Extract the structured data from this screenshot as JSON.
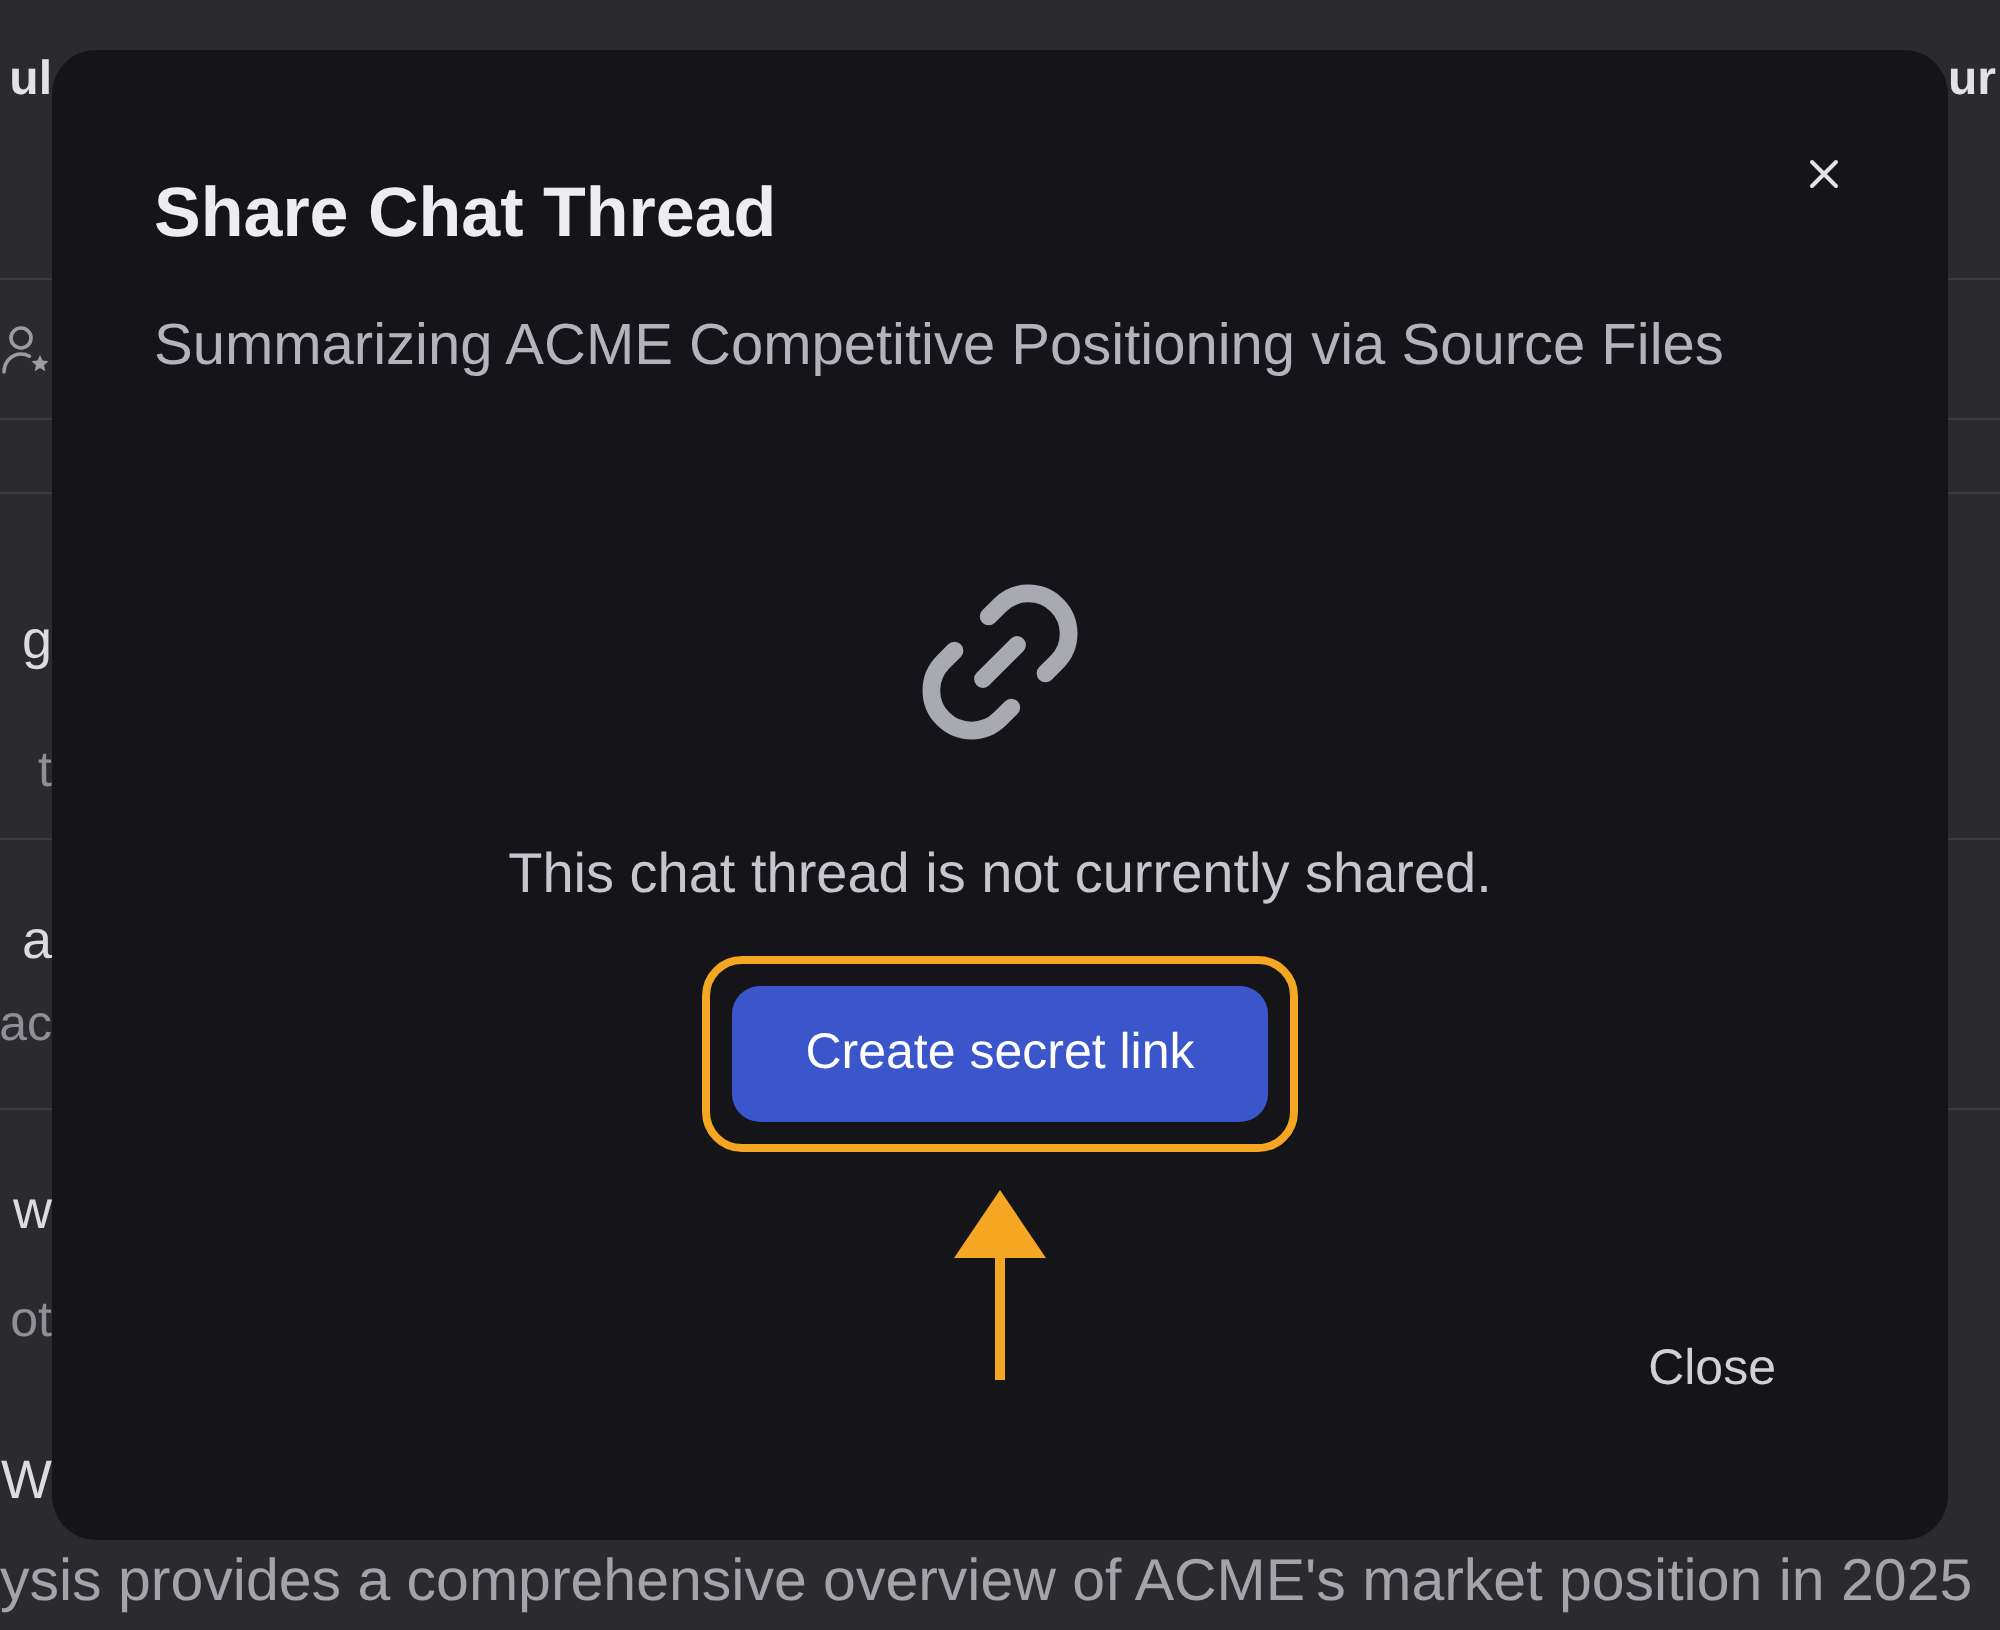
{
  "background": {
    "header": {
      "left_text": "ul",
      "right_text": "ur"
    },
    "items": [
      {
        "title": "g",
        "subtitle": "t"
      },
      {
        "title": "a",
        "subtitle": "ac"
      },
      {
        "title": "w",
        "subtitle": "ot"
      }
    ],
    "report": {
      "heading": "W",
      "summary": "ysis provides a comprehensive overview of ACME's market position in 2025"
    }
  },
  "dialog": {
    "title": "Share Chat Thread",
    "subtitle": "Summarizing ACME Competitive Positioning via Source Files",
    "message": "This chat thread is not currently shared.",
    "primary_button": {
      "label": "Create secret link",
      "highlighted": true
    },
    "secondary_button": {
      "label": "Close"
    }
  }
}
